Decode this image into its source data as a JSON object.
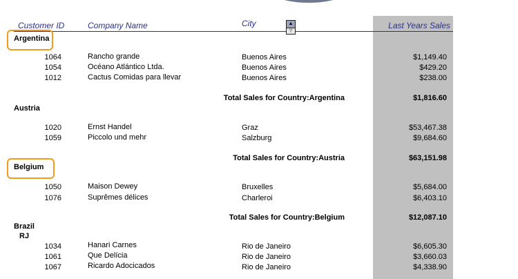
{
  "columns": {
    "customer_id": "Customer ID",
    "company_name": "Company Name",
    "city": "City",
    "sales": "Last Years Sales"
  },
  "groups": [
    {
      "country": "Argentina",
      "rows": [
        {
          "id": "1064",
          "company": "Rancho grande",
          "city": "Buenos Aires",
          "sales": "$1,149.40"
        },
        {
          "id": "1054",
          "company": "Océano Atlántico Ltda.",
          "city": "Buenos Aires",
          "sales": "$429.20"
        },
        {
          "id": "1012",
          "company": "Cactus Comidas para llevar",
          "city": "Buenos Aires",
          "sales": "$238.00"
        }
      ],
      "total_label": "Total Sales for Country:Argentina",
      "total_value": "$1,816.60"
    },
    {
      "country": "Austria",
      "rows": [
        {
          "id": "1020",
          "company": "Ernst Handel",
          "city": "Graz",
          "sales": "$53,467.38"
        },
        {
          "id": "1059",
          "company": "Piccolo und mehr",
          "city": "Salzburg",
          "sales": "$9,684.60"
        }
      ],
      "total_label": "Total Sales for Country:Austria",
      "total_value": "$63,151.98"
    },
    {
      "country": "Belgium",
      "rows": [
        {
          "id": "1050",
          "company": "Maison Dewey",
          "city": "Bruxelles",
          "sales": "$5,684.00"
        },
        {
          "id": "1076",
          "company": "Suprêmes délices",
          "city": "Charleroi",
          "sales": "$6,403.10"
        }
      ],
      "total_label": "Total Sales for Country:Belgium",
      "total_value": "$12,087.10"
    },
    {
      "country": "Brazil",
      "region": "RJ",
      "rows": [
        {
          "id": "1034",
          "company": "Hanari Carnes",
          "city": "Rio de Janeiro",
          "sales": "$6,605.30"
        },
        {
          "id": "1061",
          "company": "Que Delícia",
          "city": "Rio de Janeiro",
          "sales": "$3,660.03"
        },
        {
          "id": "1067",
          "company": "Ricardo Adocicados",
          "city": "Rio de Janeiro",
          "sales": "$4,338.90"
        }
      ]
    }
  ],
  "colors": {
    "header_text": "#2b2f8f",
    "sales_column_bg": "#c0c0c0",
    "highlight": "#f39a1e"
  },
  "icons": {
    "scroll_up": "scroll-up-arrow-icon",
    "scroll_down": "scroll-down-arrow-icon"
  }
}
